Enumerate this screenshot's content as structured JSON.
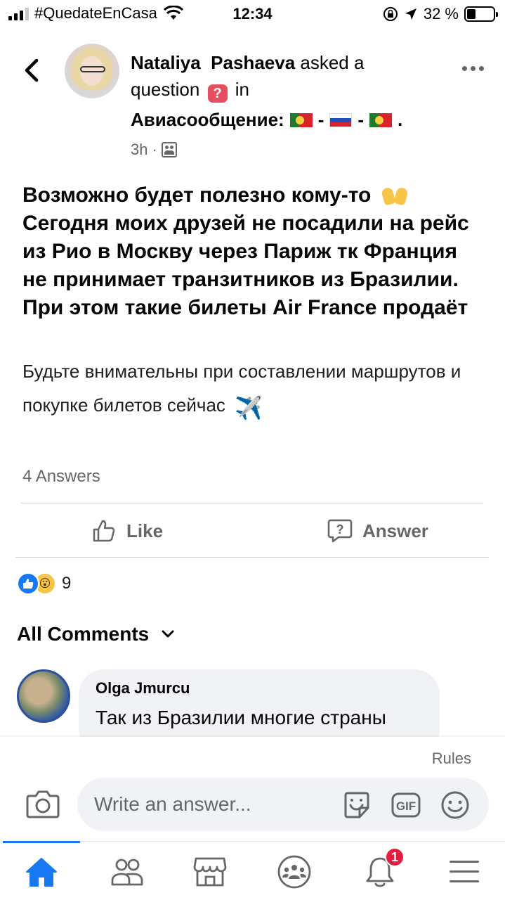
{
  "status_bar": {
    "carrier": "#QuedateEnCasa",
    "time": "12:34",
    "battery_percent": "32 %",
    "battery_level": 0.32
  },
  "post": {
    "author": "Nataliya  Pashaeva",
    "action_text": "asked a question",
    "action_in": "in",
    "group_name": "Авиасообщение:",
    "group_suffix_sep1": "-",
    "group_suffix_sep2": "-",
    "group_suffix_end": ".",
    "time_ago": "3h",
    "meta_separator": "·",
    "headline": "Возможно будет полезно кому-то",
    "headline_body": "Сегодня моих друзей не посадили на рейс из Рио в Москву через Париж тк Франция не принимает транзитников из Бразилии. При этом такие билеты Air France продаёт",
    "subtext": "Будьте внимательны при составлении маршрутов и покупке билетов сейчас",
    "plane_emoji": "✈️",
    "answers_count": "4 Answers",
    "like_label": "Like",
    "answer_label": "Answer",
    "reaction_count": "9",
    "reaction_wow_glyph": "😮"
  },
  "comments_section": {
    "filter_label": "All Comments"
  },
  "comment": {
    "name": "Olga Jmurcu",
    "text": "Так из Бразилии многие страны Европы не принимают. Так же"
  },
  "composer": {
    "rules_label": "Rules",
    "placeholder": "Write an answer..."
  },
  "bottom_nav": {
    "notifications_badge": "1",
    "accent": "#1877f2"
  },
  "colors": {
    "accent": "#1877f2",
    "secondary_text": "#65676b",
    "badge_red": "#e41e3f"
  }
}
